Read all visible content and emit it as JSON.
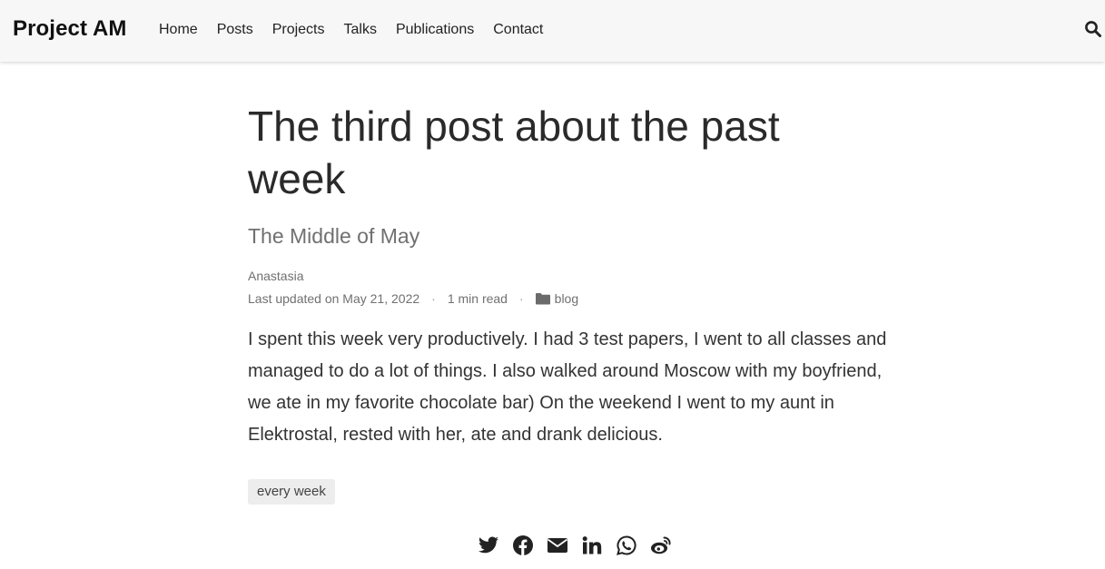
{
  "site": {
    "brand": "Project AM",
    "nav": [
      {
        "label": "Home"
      },
      {
        "label": "Posts"
      },
      {
        "label": "Projects"
      },
      {
        "label": "Talks"
      },
      {
        "label": "Publications"
      },
      {
        "label": "Contact"
      }
    ],
    "search_icon": "search-icon"
  },
  "post": {
    "title": "The third post about the past week",
    "subtitle": "The Middle of May",
    "author": "Anastasia",
    "last_updated": "Last updated on May 21, 2022",
    "read_time": "1 min read",
    "category": "blog",
    "category_icon": "folder-icon",
    "body": "I spent this week very productively. I had 3 test papers, I went to all classes and managed to do a lot of things. I also walked around Moscow with my boyfriend, we ate in my favorite chocolate bar) On the weekend I went to my aunt in Elektrostal, rested with her, ate and drank delicious.",
    "tags": [
      "every week"
    ]
  },
  "share": {
    "icons": [
      "twitter-icon",
      "facebook-icon",
      "email-icon",
      "linkedin-icon",
      "whatsapp-icon",
      "weibo-icon"
    ]
  },
  "colors": {
    "navbar_bg": "#f7f7f7",
    "text": "#2b2b2b",
    "muted": "#707070",
    "tag_bg": "#ededed"
  }
}
